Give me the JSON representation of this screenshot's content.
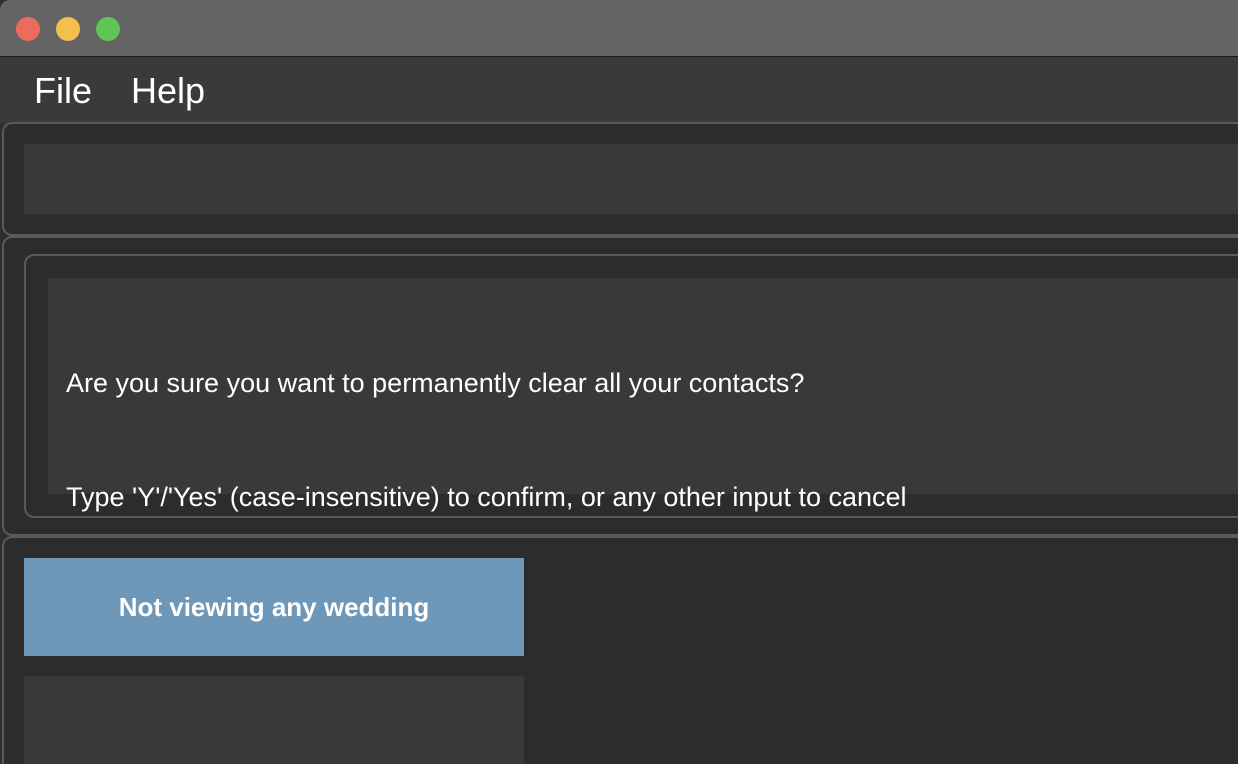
{
  "menu": {
    "file_label": "File",
    "help_label": "Help"
  },
  "command": {
    "value": ""
  },
  "result": {
    "lines": [
      "Are you sure you want to permanently clear all your contacts?",
      "Type 'Y'/'Yes' (case-insensitive) to confirm, or any other input to cancel"
    ]
  },
  "wedding": {
    "status_label": "Not viewing any wedding"
  },
  "colors": {
    "close": "#ed6a5e",
    "minimize": "#f4bf4f",
    "zoom": "#61c554",
    "wedding_banner": "#6f97b8"
  }
}
